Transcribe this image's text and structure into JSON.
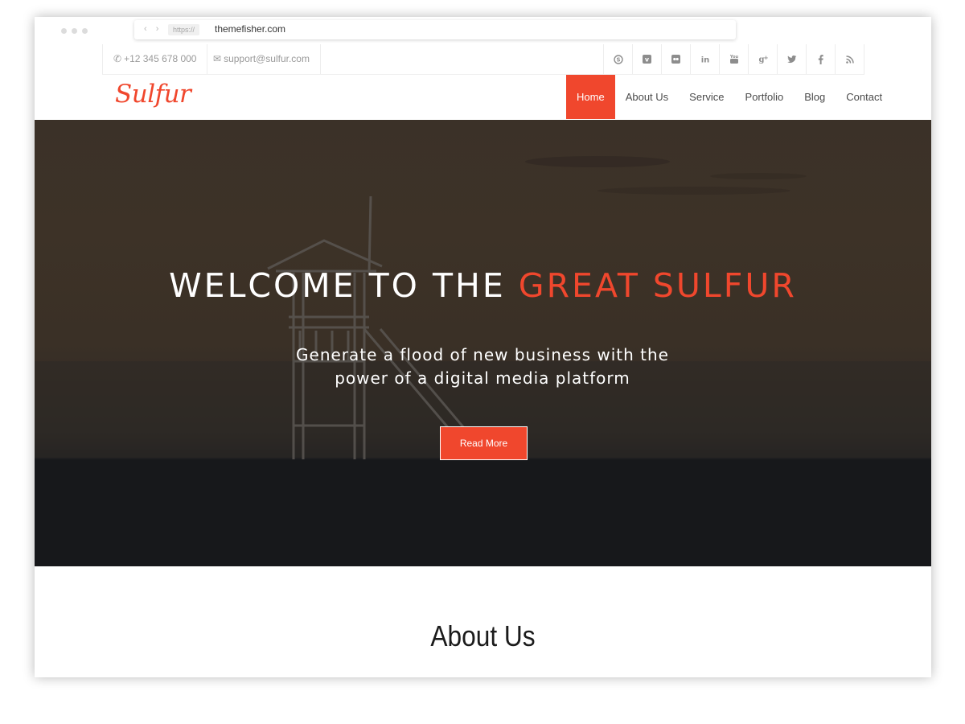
{
  "browser": {
    "scheme": "https://",
    "nav_arrows": "‹ ›",
    "domain": "themefisher.com"
  },
  "topbar": {
    "phone": "+12 345 678 000",
    "email": "support@sulfur.com",
    "socials": [
      "skype-icon",
      "vimeo-icon",
      "flickr-icon",
      "linkedin-icon",
      "youtube-icon",
      "google-plus-icon",
      "twitter-icon",
      "facebook-icon",
      "rss-icon"
    ]
  },
  "navbar": {
    "logo": "Sulfur",
    "items": [
      {
        "label": "Home",
        "active": true
      },
      {
        "label": "About Us",
        "active": false
      },
      {
        "label": "Service",
        "active": false
      },
      {
        "label": "Portfolio",
        "active": false
      },
      {
        "label": "Blog",
        "active": false
      },
      {
        "label": "Contact",
        "active": false
      }
    ]
  },
  "hero": {
    "title_plain": "WELCOME TO THE ",
    "title_accent": "GREAT SULFUR",
    "subtitle_line1": "Generate a flood of new business with the",
    "subtitle_line2": "power of a digital media platform",
    "button": "Read More"
  },
  "about": {
    "title": "About Us"
  },
  "colors": {
    "accent": "#f0472d",
    "text_dark": "#1b1b1b",
    "muted": "#9a9a9a"
  }
}
